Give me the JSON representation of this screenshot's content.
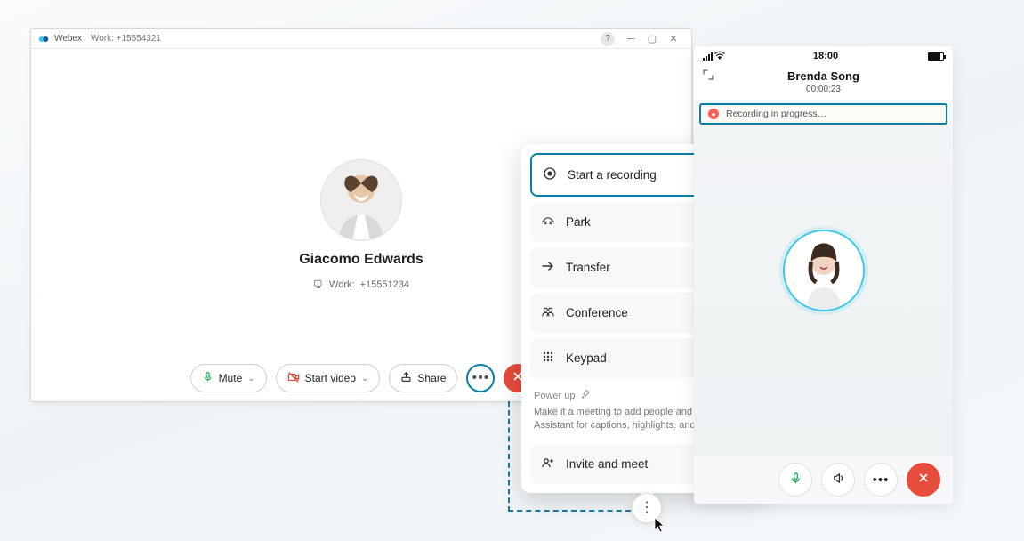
{
  "app": {
    "name": "Webex",
    "subtitle": "Work: +15554321"
  },
  "contact": {
    "name": "Giacomo Edwards",
    "line_label": "Work:",
    "line_number": "+15551234"
  },
  "toolbar": {
    "mute": "Mute",
    "start_video": "Start video",
    "share": "Share"
  },
  "menu": {
    "start_recording": "Start a recording",
    "park": "Park",
    "transfer": "Transfer",
    "conference": "Conference",
    "keypad": "Keypad",
    "powerup_title": "Power up",
    "powerup_desc": "Make it a meeting to add people and to use Webex Assistant for captions, highlights, and a transcript.",
    "invite": "Invite and meet"
  },
  "mobile": {
    "time": "18:00",
    "contact_name": "Brenda Song",
    "duration": "00:00:23",
    "recording_text": "Recording in progress…"
  }
}
